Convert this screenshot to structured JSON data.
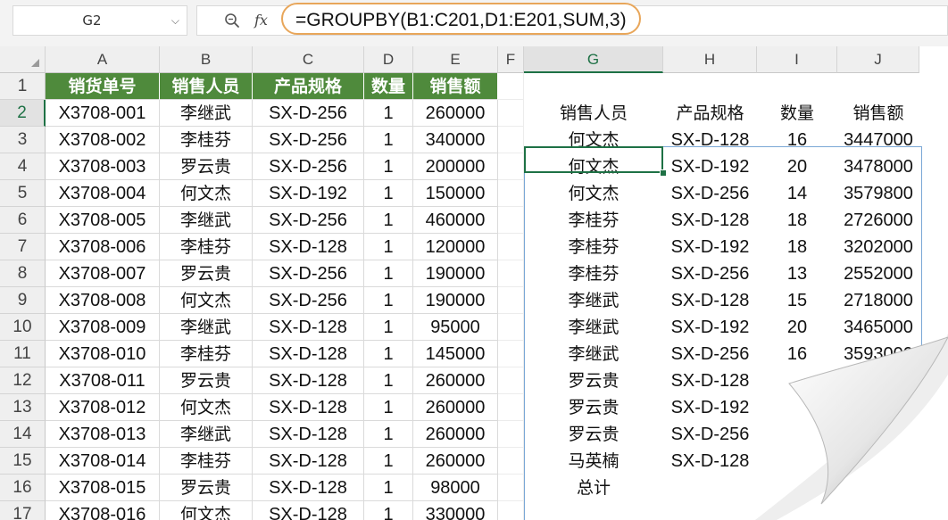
{
  "name_box": {
    "value": "G2",
    "arrow": "⌵"
  },
  "formula_bar": {
    "fx_label": "fx",
    "formula": "=GROUPBY(B1:C201,D1:E201,SUM,3)"
  },
  "columns": [
    "A",
    "B",
    "C",
    "D",
    "E",
    "F",
    "G",
    "H",
    "I",
    "J"
  ],
  "rows": [
    "1",
    "2",
    "3",
    "4",
    "5",
    "6",
    "7",
    "8",
    "9",
    "10",
    "11",
    "12",
    "13",
    "14",
    "15",
    "16",
    "17"
  ],
  "source_table": {
    "headers": [
      "销货单号",
      "销售人员",
      "产品规格",
      "数量",
      "销售额"
    ],
    "rows": [
      [
        "X3708-001",
        "李继武",
        "SX-D-256",
        "1",
        "260000"
      ],
      [
        "X3708-002",
        "李桂芬",
        "SX-D-256",
        "1",
        "340000"
      ],
      [
        "X3708-003",
        "罗云贵",
        "SX-D-256",
        "1",
        "200000"
      ],
      [
        "X3708-004",
        "何文杰",
        "SX-D-192",
        "1",
        "150000"
      ],
      [
        "X3708-005",
        "李继武",
        "SX-D-256",
        "1",
        "460000"
      ],
      [
        "X3708-006",
        "李桂芬",
        "SX-D-128",
        "1",
        "120000"
      ],
      [
        "X3708-007",
        "罗云贵",
        "SX-D-256",
        "1",
        "190000"
      ],
      [
        "X3708-008",
        "何文杰",
        "SX-D-256",
        "1",
        "190000"
      ],
      [
        "X3708-009",
        "李继武",
        "SX-D-128",
        "1",
        "95000"
      ],
      [
        "X3708-010",
        "李桂芬",
        "SX-D-128",
        "1",
        "145000"
      ],
      [
        "X3708-011",
        "罗云贵",
        "SX-D-128",
        "1",
        "260000"
      ],
      [
        "X3708-012",
        "何文杰",
        "SX-D-128",
        "1",
        "260000"
      ],
      [
        "X3708-013",
        "李继武",
        "SX-D-128",
        "1",
        "260000"
      ],
      [
        "X3708-014",
        "李桂芬",
        "SX-D-128",
        "1",
        "260000"
      ],
      [
        "X3708-015",
        "罗云贵",
        "SX-D-128",
        "1",
        "98000"
      ],
      [
        "X3708-016",
        "何文杰",
        "SX-D-128",
        "1",
        "330000"
      ]
    ]
  },
  "result_table": {
    "headers": [
      "销售人员",
      "产品规格",
      "数量",
      "销售额"
    ],
    "rows": [
      [
        "何文杰",
        "SX-D-128",
        "16",
        "3447000"
      ],
      [
        "何文杰",
        "SX-D-192",
        "20",
        "3478000"
      ],
      [
        "何文杰",
        "SX-D-256",
        "14",
        "3579800"
      ],
      [
        "李桂芬",
        "SX-D-128",
        "18",
        "2726000"
      ],
      [
        "李桂芬",
        "SX-D-192",
        "18",
        "3202000"
      ],
      [
        "李桂芬",
        "SX-D-256",
        "13",
        "2552000"
      ],
      [
        "李继武",
        "SX-D-128",
        "15",
        "2718000"
      ],
      [
        "李继武",
        "SX-D-192",
        "20",
        "3465000"
      ],
      [
        "李继武",
        "SX-D-256",
        "16",
        "3593000"
      ],
      [
        "罗云贵",
        "SX-D-128",
        "",
        ""
      ],
      [
        "罗云贵",
        "SX-D-192",
        "",
        ""
      ],
      [
        "罗云贵",
        "SX-D-256",
        "",
        ""
      ],
      [
        "马英楠",
        "SX-D-128",
        "",
        ""
      ],
      [
        "总计",
        "",
        "",
        ""
      ]
    ]
  },
  "colors": {
    "header_green": "#4f8a3c",
    "selection_green": "#1e7145",
    "formula_outline": "#e8a65a",
    "spill_border": "#7aa7d6"
  }
}
